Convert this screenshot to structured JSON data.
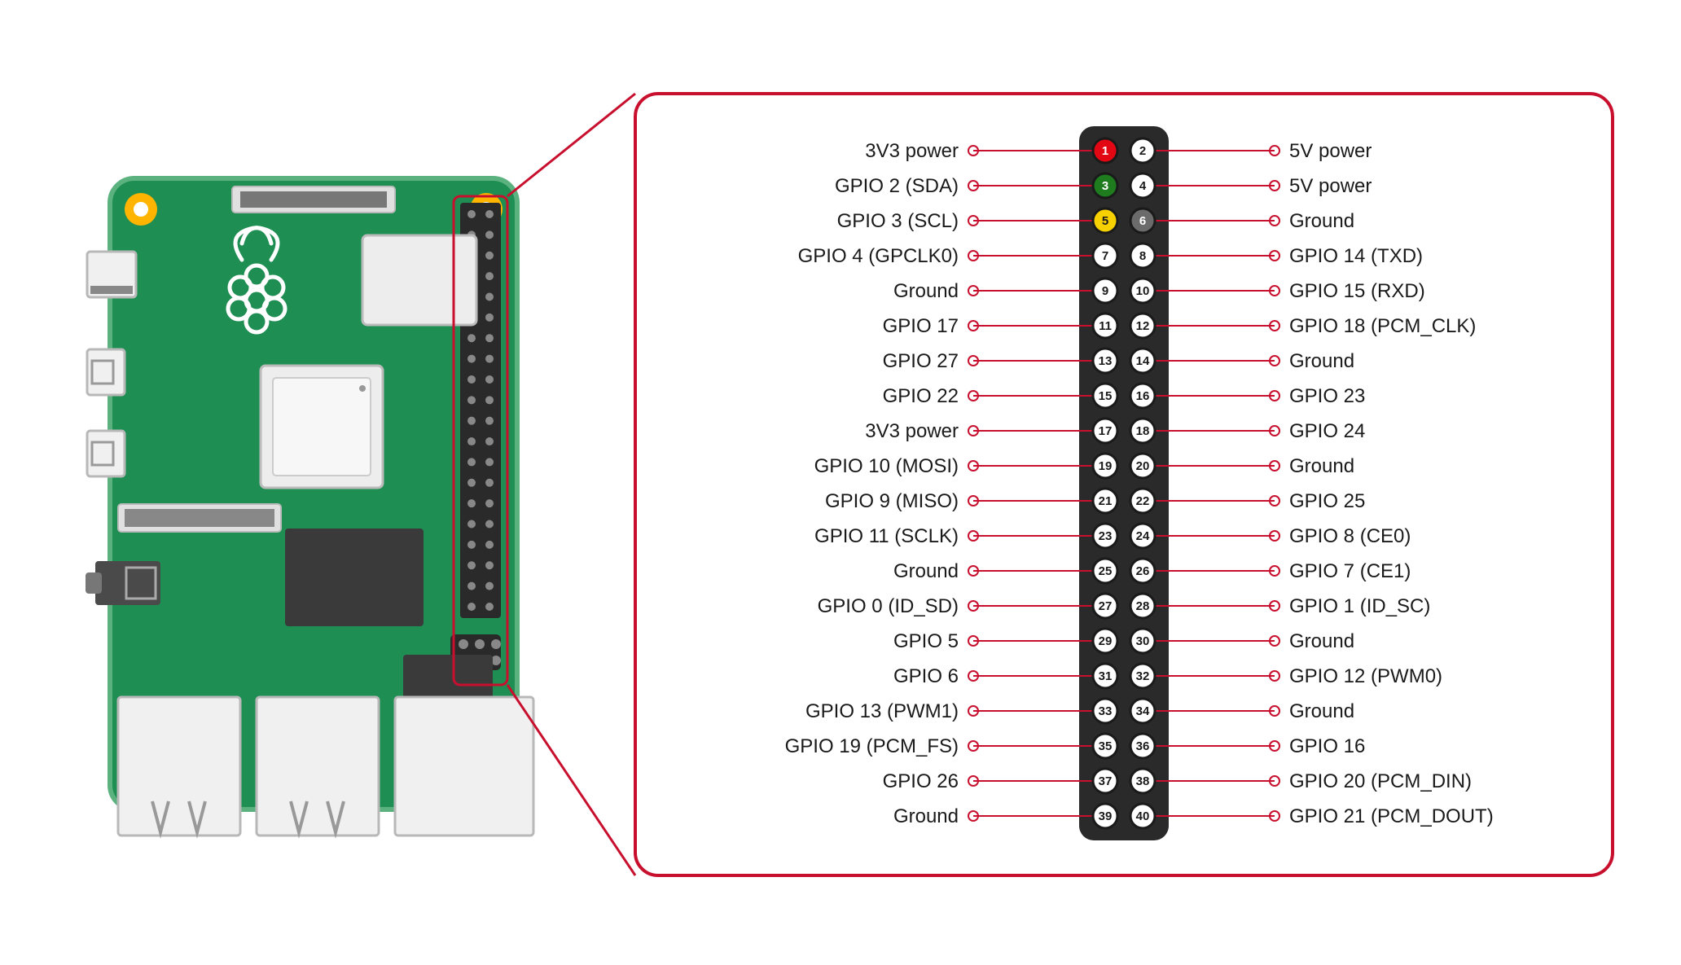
{
  "colors": {
    "accent": "#C8102E",
    "board_green": "#1E8E52",
    "board_green_light": "#5BB27F",
    "mount_hole": "#FFB400",
    "header_dark": "#2A2A2A",
    "chip_dark": "#3A3A3A",
    "port_fill": "#F0F0F0",
    "port_stroke": "#B8B8B8",
    "pin_red": "#E30613",
    "pin_green": "#1E7B1E",
    "pin_yellow": "#F7D000",
    "pin_gray": "#6B6B6B",
    "pin_white": "#FFFFFF",
    "text": "#1A1A1A"
  },
  "pins": {
    "left": [
      {
        "n": 1,
        "label": "3V3 power",
        "fill": "pin_red",
        "numc": "#fff"
      },
      {
        "n": 3,
        "label": "GPIO 2 (SDA)",
        "fill": "pin_green",
        "numc": "#fff"
      },
      {
        "n": 5,
        "label": "GPIO 3 (SCL)",
        "fill": "pin_yellow",
        "numc": "#1A1A1A"
      },
      {
        "n": 7,
        "label": "GPIO 4 (GPCLK0)",
        "fill": "pin_white",
        "numc": "#1A1A1A"
      },
      {
        "n": 9,
        "label": "Ground",
        "fill": "pin_white",
        "numc": "#1A1A1A"
      },
      {
        "n": 11,
        "label": "GPIO 17",
        "fill": "pin_white",
        "numc": "#1A1A1A"
      },
      {
        "n": 13,
        "label": "GPIO 27",
        "fill": "pin_white",
        "numc": "#1A1A1A"
      },
      {
        "n": 15,
        "label": "GPIO 22",
        "fill": "pin_white",
        "numc": "#1A1A1A"
      },
      {
        "n": 17,
        "label": "3V3 power",
        "fill": "pin_white",
        "numc": "#1A1A1A"
      },
      {
        "n": 19,
        "label": "GPIO 10 (MOSI)",
        "fill": "pin_white",
        "numc": "#1A1A1A"
      },
      {
        "n": 21,
        "label": "GPIO 9 (MISO)",
        "fill": "pin_white",
        "numc": "#1A1A1A"
      },
      {
        "n": 23,
        "label": "GPIO 11 (SCLK)",
        "fill": "pin_white",
        "numc": "#1A1A1A"
      },
      {
        "n": 25,
        "label": "Ground",
        "fill": "pin_white",
        "numc": "#1A1A1A"
      },
      {
        "n": 27,
        "label": "GPIO 0 (ID_SD)",
        "fill": "pin_white",
        "numc": "#1A1A1A"
      },
      {
        "n": 29,
        "label": "GPIO 5",
        "fill": "pin_white",
        "numc": "#1A1A1A"
      },
      {
        "n": 31,
        "label": "GPIO 6",
        "fill": "pin_white",
        "numc": "#1A1A1A"
      },
      {
        "n": 33,
        "label": "GPIO 13 (PWM1)",
        "fill": "pin_white",
        "numc": "#1A1A1A"
      },
      {
        "n": 35,
        "label": "GPIO 19 (PCM_FS)",
        "fill": "pin_white",
        "numc": "#1A1A1A"
      },
      {
        "n": 37,
        "label": "GPIO 26",
        "fill": "pin_white",
        "numc": "#1A1A1A"
      },
      {
        "n": 39,
        "label": "Ground",
        "fill": "pin_white",
        "numc": "#1A1A1A"
      }
    ],
    "right": [
      {
        "n": 2,
        "label": "5V power",
        "fill": "pin_white",
        "numc": "#1A1A1A"
      },
      {
        "n": 4,
        "label": "5V power",
        "fill": "pin_white",
        "numc": "#1A1A1A"
      },
      {
        "n": 6,
        "label": "Ground",
        "fill": "pin_gray",
        "numc": "#fff"
      },
      {
        "n": 8,
        "label": "GPIO 14 (TXD)",
        "fill": "pin_white",
        "numc": "#1A1A1A"
      },
      {
        "n": 10,
        "label": "GPIO 15 (RXD)",
        "fill": "pin_white",
        "numc": "#1A1A1A"
      },
      {
        "n": 12,
        "label": "GPIO 18 (PCM_CLK)",
        "fill": "pin_white",
        "numc": "#1A1A1A"
      },
      {
        "n": 14,
        "label": "Ground",
        "fill": "pin_white",
        "numc": "#1A1A1A"
      },
      {
        "n": 16,
        "label": "GPIO 23",
        "fill": "pin_white",
        "numc": "#1A1A1A"
      },
      {
        "n": 18,
        "label": "GPIO 24",
        "fill": "pin_white",
        "numc": "#1A1A1A"
      },
      {
        "n": 20,
        "label": "Ground",
        "fill": "pin_white",
        "numc": "#1A1A1A"
      },
      {
        "n": 22,
        "label": "GPIO 25",
        "fill": "pin_white",
        "numc": "#1A1A1A"
      },
      {
        "n": 24,
        "label": "GPIO 8 (CE0)",
        "fill": "pin_white",
        "numc": "#1A1A1A"
      },
      {
        "n": 26,
        "label": "GPIO 7 (CE1)",
        "fill": "pin_white",
        "numc": "#1A1A1A"
      },
      {
        "n": 28,
        "label": "GPIO 1 (ID_SC)",
        "fill": "pin_white",
        "numc": "#1A1A1A"
      },
      {
        "n": 30,
        "label": "Ground",
        "fill": "pin_white",
        "numc": "#1A1A1A"
      },
      {
        "n": 32,
        "label": "GPIO 12 (PWM0)",
        "fill": "pin_white",
        "numc": "#1A1A1A"
      },
      {
        "n": 34,
        "label": "Ground",
        "fill": "pin_white",
        "numc": "#1A1A1A"
      },
      {
        "n": 36,
        "label": "GPIO 16",
        "fill": "pin_white",
        "numc": "#1A1A1A"
      },
      {
        "n": 38,
        "label": "GPIO 20 (PCM_DIN)",
        "fill": "pin_white",
        "numc": "#1A1A1A"
      },
      {
        "n": 40,
        "label": "GPIO 21 (PCM_DOUT)",
        "fill": "pin_white",
        "numc": "#1A1A1A"
      }
    ]
  }
}
